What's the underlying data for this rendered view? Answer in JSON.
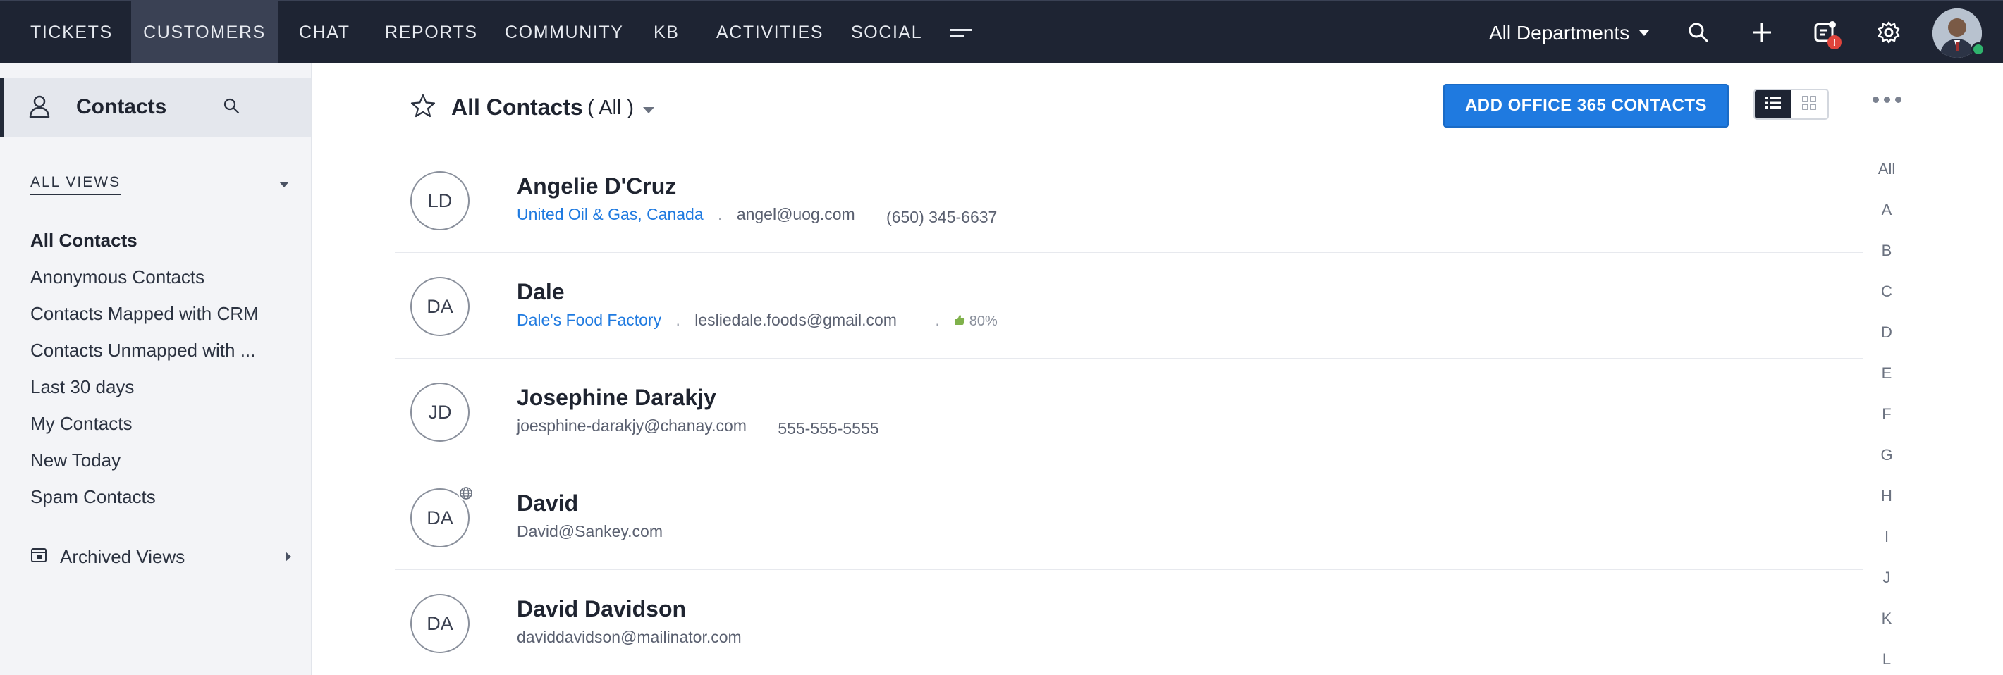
{
  "nav": {
    "items": [
      "TICKETS",
      "CUSTOMERS",
      "CHAT",
      "REPORTS",
      "COMMUNITY",
      "KB",
      "ACTIVITIES",
      "SOCIAL"
    ],
    "active": "CUSTOMERS",
    "department": "All Departments",
    "notification_badge": "!"
  },
  "sidebar": {
    "module": "Contacts",
    "views_heading": "ALL VIEWS",
    "views": [
      "All Contacts",
      "Anonymous Contacts",
      "Contacts Mapped with CRM",
      "Contacts Unmapped with ...",
      "Last 30 days",
      "My Contacts",
      "New Today",
      "Spam Contacts"
    ],
    "active_view": "All Contacts",
    "archived": "Archived Views"
  },
  "list": {
    "title": "All Contacts",
    "filter": "( All )",
    "add_button": "ADD OFFICE 365 CONTACTS"
  },
  "contacts": [
    {
      "initials": "LD",
      "name": "Angelie D'Cruz",
      "account": "United Oil & Gas, Canada",
      "email": "angel@uog.com",
      "phone": "(650) 345-6637",
      "happiness": ""
    },
    {
      "initials": "DA",
      "name": "Dale",
      "account": "Dale's Food Factory",
      "email": "lesliedale.foods@gmail.com",
      "phone": "",
      "happiness": "80%"
    },
    {
      "initials": "JD",
      "name": "Josephine Darakjy",
      "account": "",
      "email": "joesphine-darakjy@chanay.com",
      "phone": "555-555-5555",
      "happiness": ""
    },
    {
      "initials": "DA",
      "name": "David",
      "account": "",
      "email": "David@Sankey.com",
      "phone": "",
      "happiness": ""
    },
    {
      "initials": "DA",
      "name": "David Davidson",
      "account": "",
      "email": "daviddavidson@mailinator.com",
      "phone": "",
      "happiness": ""
    }
  ],
  "alpha_index": [
    "All",
    "A",
    "B",
    "C",
    "D",
    "E",
    "F",
    "G",
    "H",
    "I",
    "J",
    "K",
    "L"
  ],
  "colors": {
    "topbar": "#1e2433",
    "accent": "#1f7ae0",
    "sidebar": "#f3f4f7"
  }
}
